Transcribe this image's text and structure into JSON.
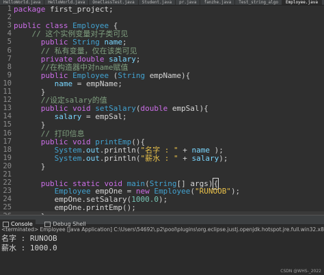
{
  "tabs": [
    "HelloWorld.java",
    "HelloWorld.java",
    "OneClassTest.java",
    "Student.java",
    "pr.java",
    "fanzhe.java",
    "Test_string_algo",
    "Employee.java"
  ],
  "code_lines": [
    {
      "n": "1",
      "tokens": [
        [
          "kw",
          "package "
        ],
        [
          "id",
          "first_project;"
        ]
      ]
    },
    {
      "n": "2",
      "tokens": []
    },
    {
      "n": "3",
      "tokens": [
        [
          "kw",
          "public class "
        ],
        [
          "typ",
          "Employee"
        ],
        [
          "pun",
          " {"
        ]
      ]
    },
    {
      "n": "4",
      "tokens": [
        [
          "cmt",
          "    // 这个实例变量对子类可见"
        ]
      ]
    },
    {
      "n": "5",
      "tokens": [
        [
          "kw",
          "      public "
        ],
        [
          "typ",
          "String "
        ],
        [
          "fld",
          "name"
        ],
        [
          "pun",
          ";"
        ]
      ]
    },
    {
      "n": "6",
      "tokens": [
        [
          "cmt",
          "      // 私有变量，仅在该类可见"
        ]
      ]
    },
    {
      "n": "7",
      "tokens": [
        [
          "kw",
          "      private double "
        ],
        [
          "fld",
          "salary"
        ],
        [
          "pun",
          ";"
        ]
      ]
    },
    {
      "n": "8",
      "tokens": [
        [
          "cmt",
          "      //在构造器中对name赋值"
        ]
      ]
    },
    {
      "n": "9",
      "tokens": [
        [
          "kw",
          "      public "
        ],
        [
          "typ",
          "Employee "
        ],
        [
          "pun",
          "("
        ],
        [
          "typ",
          "String "
        ],
        [
          "id",
          "empName"
        ],
        [
          "pun",
          "){"
        ]
      ]
    },
    {
      "n": "10",
      "tokens": [
        [
          "fld",
          "         name"
        ],
        [
          "pun",
          " = "
        ],
        [
          "id",
          "empName"
        ],
        [
          "pun",
          ";"
        ]
      ]
    },
    {
      "n": "11",
      "tokens": [
        [
          "pun",
          "      }"
        ]
      ]
    },
    {
      "n": "12",
      "tokens": [
        [
          "cmt",
          "      //设定salary的值"
        ]
      ]
    },
    {
      "n": "13",
      "tokens": [
        [
          "kw",
          "      public void "
        ],
        [
          "typ",
          "setSalary"
        ],
        [
          "pun",
          "("
        ],
        [
          "kw",
          "double "
        ],
        [
          "id",
          "empSal"
        ],
        [
          "pun",
          "){"
        ]
      ]
    },
    {
      "n": "14",
      "tokens": [
        [
          "fld",
          "         salary"
        ],
        [
          "pun",
          " = "
        ],
        [
          "id",
          "empSal"
        ],
        [
          "pun",
          ";"
        ]
      ]
    },
    {
      "n": "15",
      "tokens": [
        [
          "pun",
          "      }"
        ]
      ]
    },
    {
      "n": "16",
      "tokens": [
        [
          "cmt",
          "      // 打印信息"
        ]
      ]
    },
    {
      "n": "17",
      "tokens": [
        [
          "kw",
          "      public void "
        ],
        [
          "typ",
          "printEmp"
        ],
        [
          "pun",
          "(){"
        ]
      ]
    },
    {
      "n": "18",
      "tokens": [
        [
          "typ",
          "         System"
        ],
        [
          "pun",
          "."
        ],
        [
          "fld",
          "out"
        ],
        [
          "pun",
          "."
        ],
        [
          "id",
          "println"
        ],
        [
          "pun",
          "("
        ],
        [
          "str",
          "\"名字 : \""
        ],
        [
          "pun",
          " + "
        ],
        [
          "fld",
          "name"
        ],
        [
          "pun",
          " );"
        ]
      ]
    },
    {
      "n": "19",
      "tokens": [
        [
          "typ",
          "         System"
        ],
        [
          "pun",
          "."
        ],
        [
          "fld",
          "out"
        ],
        [
          "pun",
          "."
        ],
        [
          "id",
          "println"
        ],
        [
          "pun",
          "("
        ],
        [
          "str",
          "\"薪水 : \""
        ],
        [
          "pun",
          " + "
        ],
        [
          "fld",
          "salary"
        ],
        [
          "pun",
          ");"
        ]
      ]
    },
    {
      "n": "20",
      "tokens": [
        [
          "pun",
          "      }"
        ]
      ]
    },
    {
      "n": "21",
      "tokens": []
    },
    {
      "n": "22",
      "tokens": [
        [
          "kw",
          "      public static void "
        ],
        [
          "typ",
          "main"
        ],
        [
          "pun",
          "("
        ],
        [
          "typ",
          "String"
        ],
        [
          "pun",
          "[] "
        ],
        [
          "id",
          "args"
        ],
        [
          "pun",
          ")"
        ],
        [
          "cur",
          "{"
        ]
      ]
    },
    {
      "n": "23",
      "tokens": [
        [
          "typ",
          "         Employee "
        ],
        [
          "id",
          "empOne"
        ],
        [
          "pun",
          " = "
        ],
        [
          "kw",
          "new "
        ],
        [
          "typ",
          "Employee"
        ],
        [
          "pun",
          "("
        ],
        [
          "str",
          "\"RUNOOB\""
        ],
        [
          "pun",
          ");"
        ]
      ]
    },
    {
      "n": "24",
      "tokens": [
        [
          "id",
          "         empOne"
        ],
        [
          "pun",
          "."
        ],
        [
          "id",
          "setSalary"
        ],
        [
          "pun",
          "("
        ],
        [
          "num",
          "1000.0"
        ],
        [
          "pun",
          ");"
        ]
      ]
    },
    {
      "n": "25",
      "tokens": [
        [
          "id",
          "         empOne"
        ],
        [
          "pun",
          "."
        ],
        [
          "id",
          "printEmp"
        ],
        [
          "pun",
          "();"
        ]
      ]
    },
    {
      "n": "26",
      "tokens": [
        [
          "pun",
          "      }"
        ]
      ]
    },
    {
      "n": "27",
      "tokens": [
        [
          "pun",
          "}"
        ]
      ]
    }
  ],
  "current_line": "26",
  "panel": {
    "console_label": "Console",
    "debug_label": "Debug Shell",
    "terminated": "<terminated> Employee [Java Application] C:\\Users\\54692\\.p2\\pool\\plugins\\org.eclipse.justj.openjdk.hotspot.jre.full.win32.x86_64_17.0.4.v20220903-1038\\jre\\",
    "output": [
      "名字 : RUNOOB",
      "薪水 : 1000.0"
    ]
  },
  "watermark": "CSDN @WHS-_2022"
}
